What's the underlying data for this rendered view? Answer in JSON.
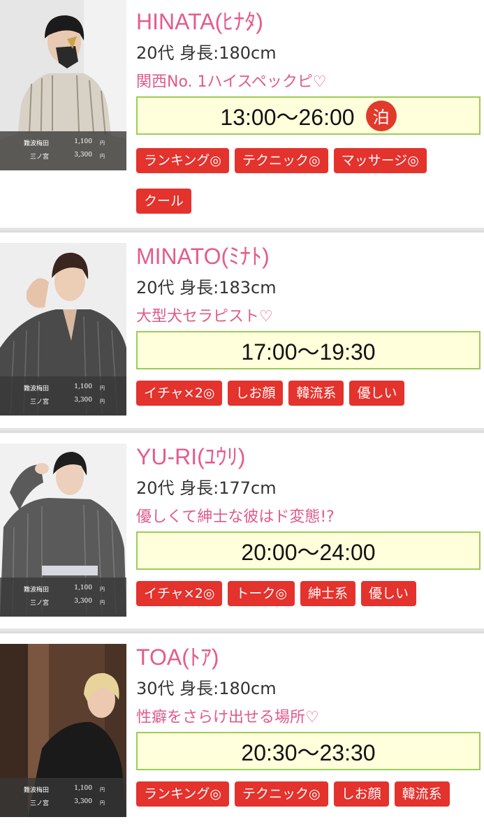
{
  "price_box": {
    "rows": [
      {
        "area": "難波梅田",
        "amount": "1,100",
        "yen": "円"
      },
      {
        "area": "三ノ宮",
        "amount": "3,300",
        "yen": "円"
      }
    ]
  },
  "casts": [
    {
      "name": "HINATA(ﾋﾅﾀ)",
      "stats": "20代 身長:180cm",
      "catch": "関西No. 1ハイスペックピ♡",
      "time": "13:00〜26:00",
      "stay": "泊",
      "tags": [
        "ランキング◎",
        "テクニック◎",
        "マッサージ◎",
        "クール"
      ]
    },
    {
      "name": "MINATO(ﾐﾅﾄ)",
      "stats": "20代 身長:183cm",
      "catch": "大型犬セラピスト♡",
      "time": "17:00〜19:30",
      "tags": [
        "イチャ×2◎",
        "しお顔",
        "韓流系",
        "優しい"
      ]
    },
    {
      "name": "YU-RI(ﾕｳﾘ)",
      "stats": "20代 身長:177cm",
      "catch": "優しくて紳士な彼はド変態!?",
      "time": "20:00〜24:00",
      "tags": [
        "イチャ×2◎",
        "トーク◎",
        "紳士系",
        "優しい"
      ]
    },
    {
      "name": "TOA(ﾄｱ)",
      "stats": "30代 身長:180cm",
      "catch": "性癖をさらけ出せる場所♡",
      "time": "20:30〜23:30",
      "tags": [
        "ランキング◎",
        "テクニック◎",
        "しお顔",
        "韓流系"
      ]
    }
  ],
  "colors": {
    "name": "#e55b8c",
    "catch": "#e05a8a",
    "time_border": "#9ccc58",
    "time_bg": "#ffffdc",
    "tag_bg": "#e4322d",
    "stay_badge": "#e23a2a"
  }
}
